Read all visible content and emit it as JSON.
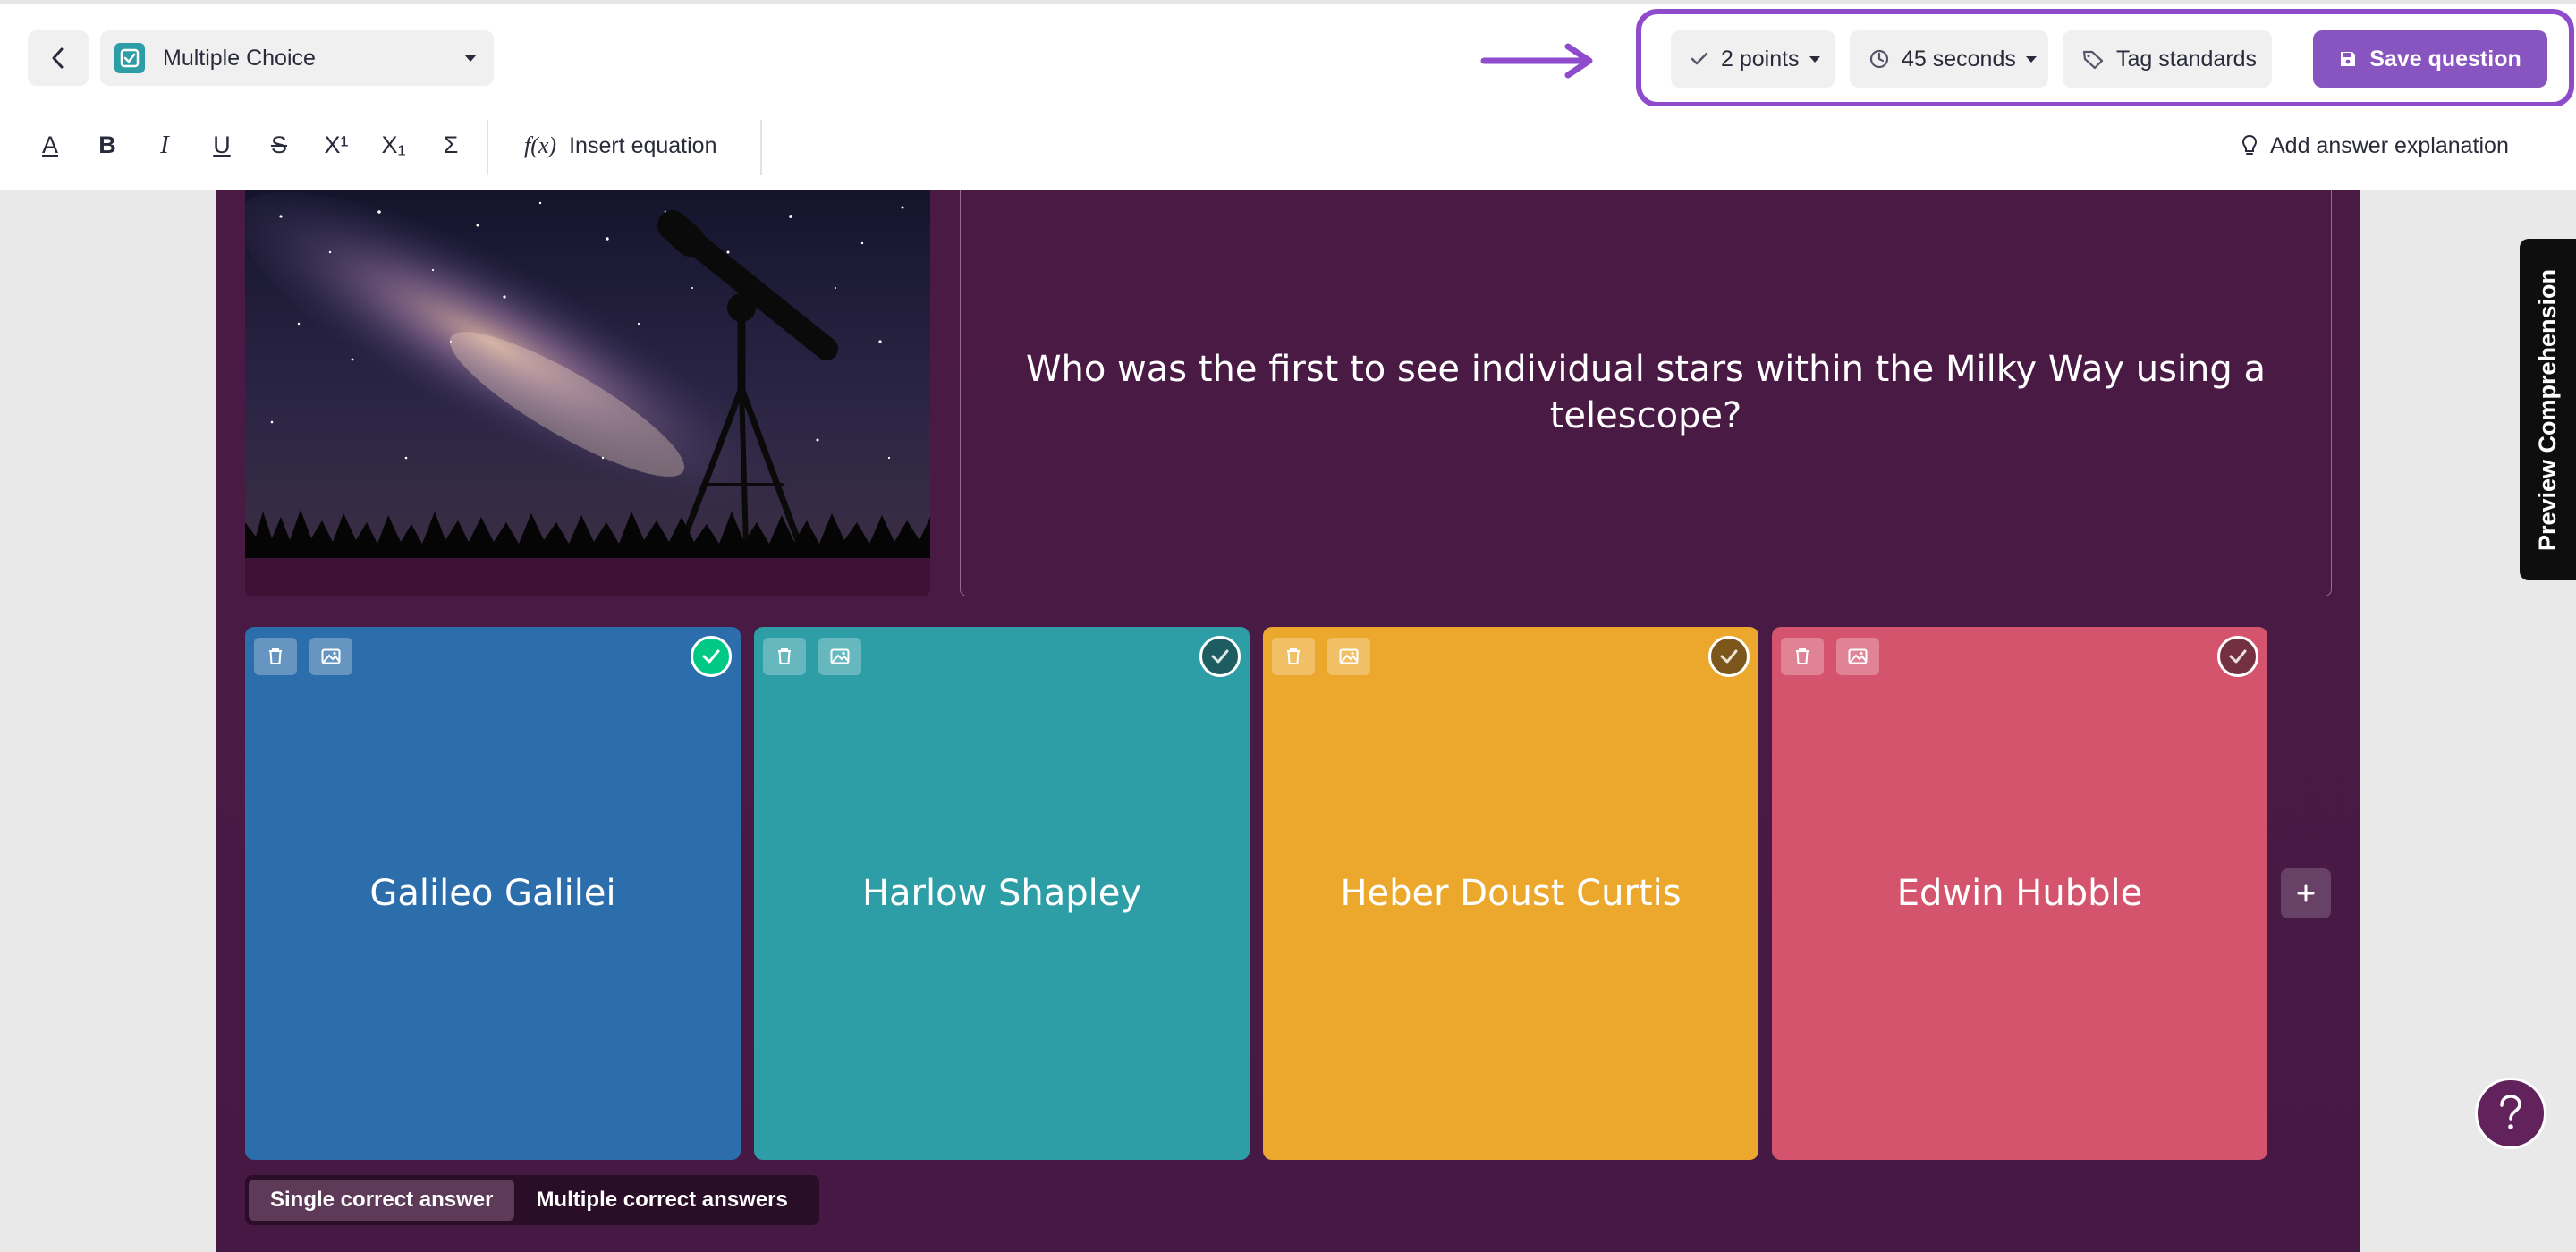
{
  "header": {
    "question_type": "Multiple Choice",
    "points": "2 points",
    "time": "45 seconds",
    "tag_label": "Tag standards",
    "save_label": "Save question"
  },
  "toolbar": {
    "buttons": [
      "A",
      "B",
      "I",
      "U",
      "S",
      "X¹",
      "X₁",
      "Σ"
    ],
    "equation_label": "Insert equation",
    "equation_icon_text": "f(x)",
    "explanation_label": "Add answer explanation"
  },
  "question": {
    "text": "Who was the first to see individual stars within the Milky Way using a telescope?",
    "image": "night-sky-telescope"
  },
  "answers": [
    {
      "text": "Galileo Galilei",
      "color": "#2c6dab",
      "correct": true
    },
    {
      "text": "Harlow Shapley",
      "color": "#2d9da6",
      "correct": false
    },
    {
      "text": "Heber Doust Curtis",
      "color": "#eca82c",
      "correct": false
    },
    {
      "text": "Edwin Hubble",
      "color": "#d5546d",
      "correct": false
    }
  ],
  "answer_mode": {
    "single": "Single correct answer",
    "multiple": "Multiple correct answers",
    "selected": "single"
  },
  "side": {
    "preview_label": "Preview Comprehension",
    "help_label": "?"
  },
  "colors": {
    "accent": "#8854c0",
    "highlight": "#8e4ccd",
    "editor_bg": "#461945",
    "correct_check": "#00c985"
  }
}
